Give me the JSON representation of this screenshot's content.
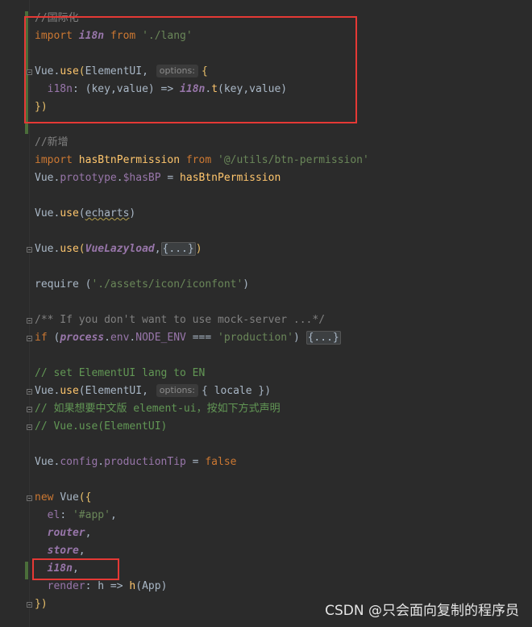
{
  "code": {
    "comment_i18n": "//国际化",
    "import_kw": "import",
    "i18n": "i18n",
    "from_kw": "from",
    "lang_path": "'./lang'",
    "vue": "Vue",
    "use": "use",
    "element_ui": "ElementUI",
    "options_hint": "options:",
    "i18n_prop": "i18n",
    "key": "key",
    "value": "value",
    "t": "t",
    "comment_new": "//新增",
    "has_btn_permission": "hasBtnPermission",
    "btn_permission_path": "'@/utils/btn-permission'",
    "prototype": "prototype",
    "has_bp": "$hasBP",
    "echarts": "echarts",
    "vue_lazyload": "VueLazyload",
    "collapsed": "{...}",
    "require": "require",
    "iconfont_path": "'./assets/icon/iconfont'",
    "mock_comment": "/** If you don't want to use mock-server ...*/",
    "if_kw": "if",
    "process": "process",
    "env": "env",
    "node_env": "NODE_ENV",
    "production": "'production'",
    "comment_lang": "// set ElementUI lang to EN",
    "locale": "locale",
    "comment_cn": "// 如果想要中文版 element-ui，按如下方式声明",
    "comment_use": "// Vue.use(ElementUI)",
    "config": "config",
    "production_tip": "productionTip",
    "false_kw": "false",
    "new_kw": "new",
    "el": "el",
    "app_sel": "'#app'",
    "router": "router",
    "store": "store",
    "render": "render",
    "h": "h",
    "app": "App"
  },
  "watermark": "CSDN @只会面向复制的程序员",
  "colors": {
    "background": "#2b2b2b",
    "keyword": "#cc7832",
    "string": "#6a8759",
    "function": "#ffc66d",
    "property": "#9876aa",
    "comment": "#808080",
    "highlight_box": "#e53935"
  }
}
